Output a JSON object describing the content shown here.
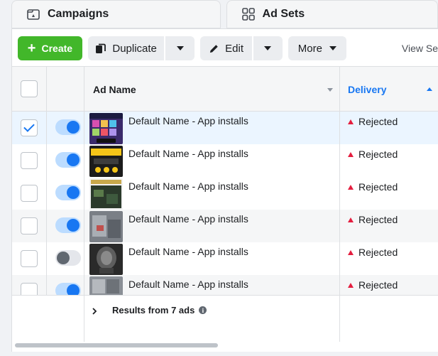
{
  "tabs": {
    "campaigns_label": "Campaigns",
    "adsets_label": "Ad Sets"
  },
  "toolbar": {
    "create_label": "Create",
    "duplicate_label": "Duplicate",
    "edit_label": "Edit",
    "more_label": "More",
    "view_setup_label": "View Se"
  },
  "table": {
    "col_name": "Ad Name",
    "col_delivery": "Delivery",
    "rows": [
      {
        "name": "Default Name - App installs",
        "delivery": "Rejected",
        "selected": true,
        "active": true
      },
      {
        "name": "Default Name - App installs",
        "delivery": "Rejected",
        "selected": false,
        "active": true
      },
      {
        "name": "Default Name - App installs",
        "delivery": "Rejected",
        "selected": false,
        "active": true
      },
      {
        "name": "Default Name - App installs",
        "delivery": "Rejected",
        "selected": false,
        "active": true
      },
      {
        "name": "Default Name - App installs",
        "delivery": "Rejected",
        "selected": false,
        "active": false
      },
      {
        "name": "Default Name - App installs",
        "delivery": "Rejected",
        "selected": false,
        "active": true
      }
    ],
    "footer_results": "Results from 7 ads"
  },
  "colors": {
    "accent": "#1877f2",
    "create": "#42b72a",
    "rejected": "#e41e3f"
  }
}
